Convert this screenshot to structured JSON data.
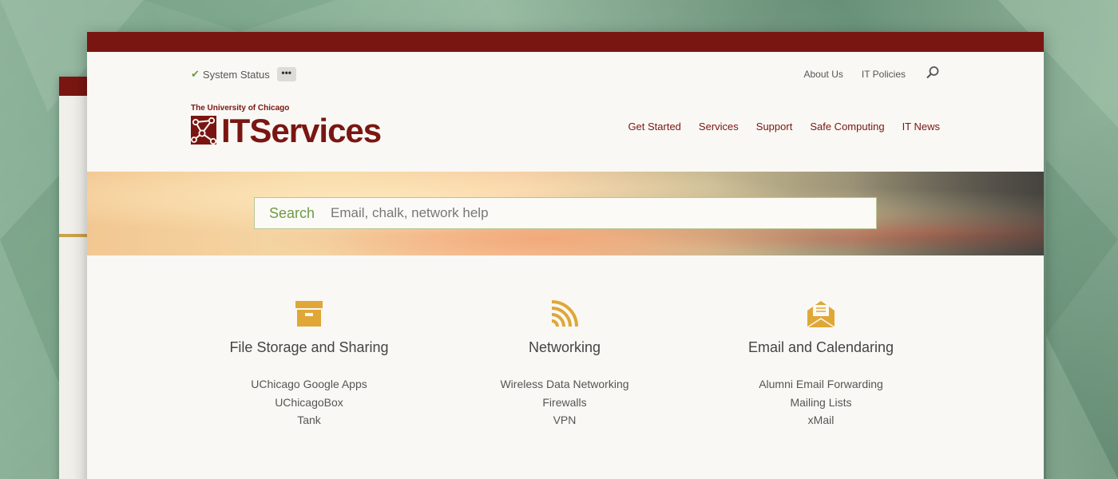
{
  "colors": {
    "brand_maroon": "#7a1612",
    "accent_gold": "#e0a737",
    "accent_green": "#6f9a4a"
  },
  "utility": {
    "status_icon": "check-icon",
    "status_label": "System Status",
    "more_label": "•••",
    "links": [
      "About Us",
      "IT Policies"
    ],
    "search_icon": "search-icon"
  },
  "brand": {
    "university": "The University of Chicago",
    "wordmark": "ITServices"
  },
  "nav": {
    "items": [
      "Get Started",
      "Services",
      "Support",
      "Safe Computing",
      "IT News"
    ]
  },
  "search": {
    "label": "Search",
    "placeholder": "Email, chalk, network help"
  },
  "categories": [
    {
      "icon": "archive-box-icon",
      "title": "File Storage and Sharing",
      "links": [
        "UChicago Google Apps",
        "UChicagoBox",
        "Tank"
      ]
    },
    {
      "icon": "wifi-signal-icon",
      "title": "Networking",
      "links": [
        "Wireless Data Networking",
        "Firewalls",
        "VPN"
      ]
    },
    {
      "icon": "open-envelope-icon",
      "title": "Email and Calendaring",
      "links": [
        "Alumni Email Forwarding",
        "Mailing Lists",
        "xMail"
      ]
    }
  ]
}
